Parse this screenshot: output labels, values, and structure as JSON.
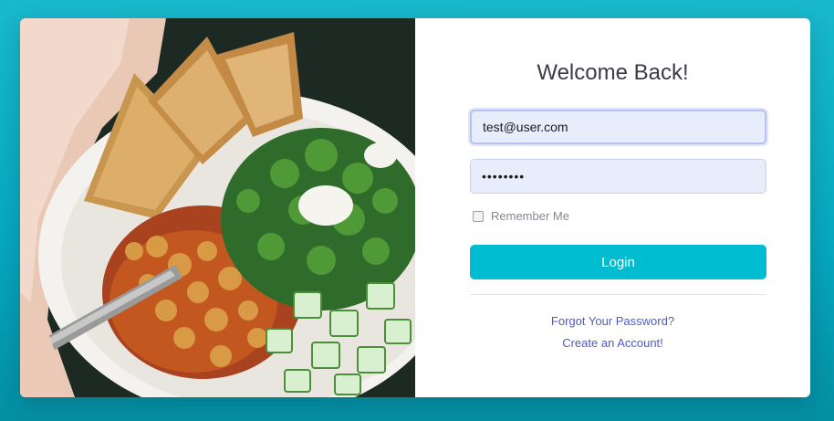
{
  "login": {
    "title": "Welcome Back!",
    "email_value": "test@user.com",
    "password_value": "••••••••",
    "remember_label": "Remember Me",
    "remember_checked": false,
    "login_label": "Login",
    "forgot_link": "Forgot Your Password?",
    "create_link": "Create an Account!"
  },
  "colors": {
    "accent": "#00bcd0",
    "background": "#0aafc4",
    "link": "#4e5bc8",
    "input_bg": "#e8edfc"
  },
  "hero": {
    "image_icon": "food-bowl-photo"
  }
}
